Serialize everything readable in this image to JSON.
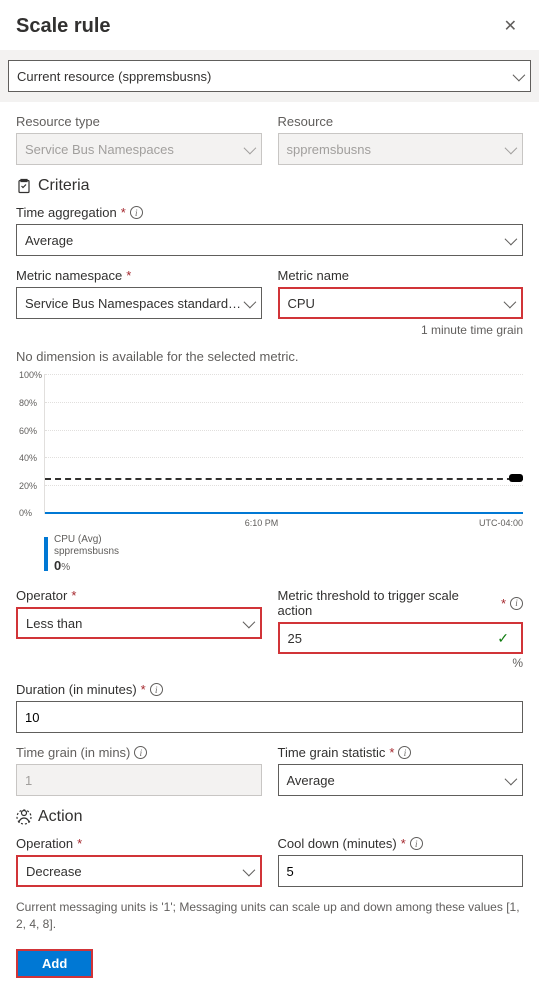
{
  "header": {
    "title": "Scale rule"
  },
  "top_resource": "Current resource (sppremsbusns)",
  "resource_type": {
    "label": "Resource type",
    "value": "Service Bus Namespaces"
  },
  "resource": {
    "label": "Resource",
    "value": "sppremsbusns"
  },
  "sections": {
    "criteria": "Criteria",
    "action": "Action"
  },
  "time_aggregation": {
    "label": "Time aggregation",
    "value": "Average"
  },
  "metric_namespace": {
    "label": "Metric namespace",
    "value": "Service Bus Namespaces standard me..."
  },
  "metric_name": {
    "label": "Metric name",
    "value": "CPU",
    "sub": "1 minute time grain"
  },
  "no_dimension": "No dimension is available for the selected metric.",
  "operator": {
    "label": "Operator",
    "value": "Less than"
  },
  "threshold": {
    "label": "Metric threshold to trigger scale action",
    "value": "25",
    "unit": "%"
  },
  "duration": {
    "label": "Duration (in minutes)",
    "value": "10"
  },
  "time_grain": {
    "label": "Time grain (in mins)",
    "value": "1"
  },
  "time_grain_statistic": {
    "label": "Time grain statistic",
    "value": "Average"
  },
  "operation": {
    "label": "Operation",
    "value": "Decrease"
  },
  "cool_down": {
    "label": "Cool down (minutes)",
    "value": "5"
  },
  "hint": "Current messaging units is '1'; Messaging units can scale up and down among these values [1, 2, 4, 8].",
  "add_button": "Add",
  "x_axis": {
    "center": "6:10 PM",
    "right": "UTC-04:00"
  },
  "legend": {
    "line1": "CPU (Avg)",
    "line2": "sppremsbusns",
    "value": "0",
    "unit": "%"
  },
  "chart_data": {
    "type": "line",
    "title": "",
    "xlabel": "",
    "ylabel": "",
    "ylim": [
      0,
      100
    ],
    "y_ticks": [
      0,
      20,
      40,
      60,
      80,
      100
    ],
    "threshold_line": 25,
    "series": [
      {
        "name": "CPU (Avg) sppremsbusns",
        "color": "#0078d4",
        "value_line": 0
      }
    ]
  }
}
